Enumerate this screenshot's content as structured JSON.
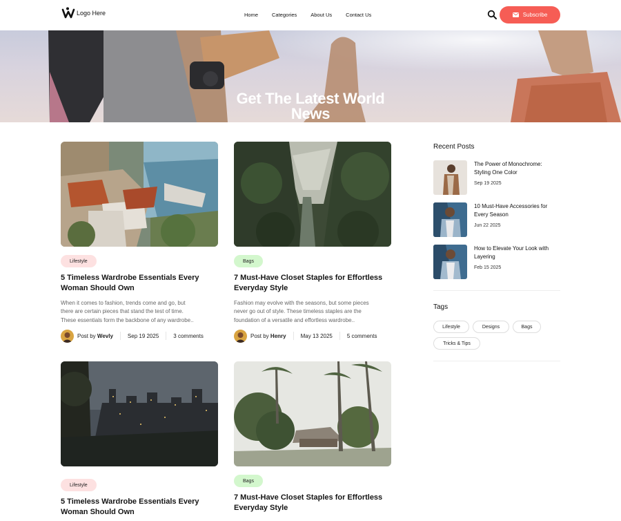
{
  "header": {
    "logo_text": "Logo Here",
    "nav": [
      "Home",
      "Categories",
      "About Us",
      "Contact Us"
    ],
    "subscribe_label": "Subscribe",
    "accent": "#f65d55"
  },
  "hero": {
    "title_line1": "Get The Latest World",
    "title_line2": "News"
  },
  "posts": [
    {
      "tag": "Lifestyle",
      "tag_color": "#fde1e1",
      "title_line1": "5 Timeless Wardrobe Essentials Every",
      "title_line2": "Woman Should Own",
      "excerpt_lines": [
        "When it comes to fashion, trends come and go, but",
        "there are certain pieces that stand the test of time.",
        "These essentials form the backbone of any wardrobe.."
      ],
      "by_prefix": "Post by",
      "author": "Wevly",
      "date": "Sep 19 2025",
      "comments": "3 comments"
    },
    {
      "tag": "Bags",
      "tag_color": "#d3f7cd",
      "title_line1": "7 Must-Have Closet Staples for Effortless",
      "title_line2": "Everyday Style",
      "excerpt_lines": [
        "Fashion may evolve with the seasons, but some pieces",
        "never go out of style. These timeless staples are the",
        "foundation of a versatile and effortless wardrobe.."
      ],
      "by_prefix": "Post by",
      "author": "Henry",
      "date": "May 13 2025",
      "comments": "5 comments"
    },
    {
      "tag": "Lifestyle",
      "tag_color": "#fde1e1",
      "title_line1": "5 Timeless Wardrobe Essentials Every",
      "title_line2": "Woman Should Own"
    },
    {
      "tag": "Bags",
      "tag_color": "#d3f7cd",
      "title_line1": "7 Must-Have Closet Staples for Effortless",
      "title_line2": "Everyday Style"
    }
  ],
  "sidebar": {
    "recent_heading": "Recent Posts",
    "recent": [
      {
        "title_line1": "The Power of Monochrome:",
        "title_line2": "Styling One Color",
        "date": "Sep 19 2025"
      },
      {
        "title_line1": "10 Must-Have Accessories for",
        "title_line2": "Every Season",
        "date": "Jun 22 2025"
      },
      {
        "title_line1": "How to Elevate Your Look with",
        "title_line2": "Layering",
        "date": "Feb 15 2025"
      }
    ],
    "tags_heading": "Tags",
    "tags": [
      "Lifestyle",
      "Designs",
      "Bags",
      "Tricks & Tips"
    ]
  },
  "icons": {
    "logo": "logo-mark-icon",
    "search": "search-icon",
    "subscribe": "mail-icon"
  }
}
